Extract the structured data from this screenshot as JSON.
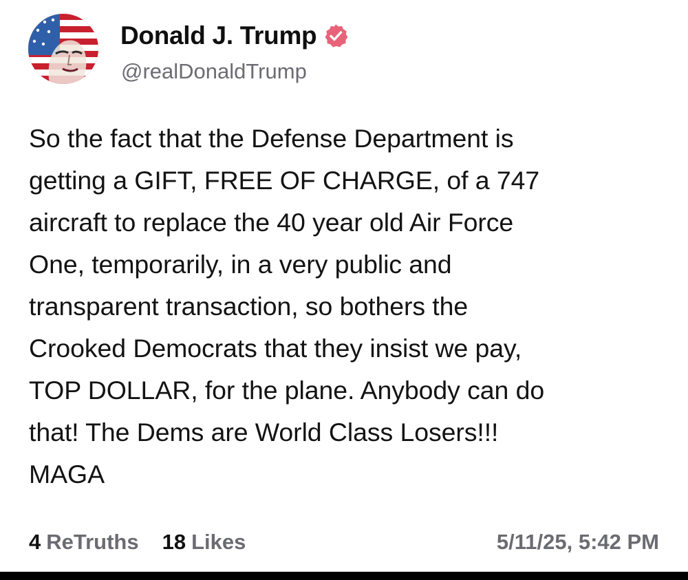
{
  "post": {
    "author": {
      "display_name": "Donald J. Trump",
      "handle": "@realDonaldTrump",
      "verified": true
    },
    "body_lines": [
      "So the fact that the Defense Department is",
      "getting a GIFT, FREE OF CHARGE, of a 747",
      "aircraft to replace the 40 year old Air Force",
      "One, temporarily, in a very public and",
      "transparent transaction, so bothers the",
      "Crooked Democrats that they insist we pay,",
      "TOP DOLLAR, for the plane. Anybody can do",
      "that! The Dems are World Class Losers!!!",
      "MAGA"
    ],
    "stats": {
      "retruths_count": "4",
      "retruths_label": "ReTruths",
      "likes_count": "18",
      "likes_label": "Likes"
    },
    "timestamp": "5/11/25, 5:42 PM"
  },
  "icons": {
    "avatar": "avatar-flag-portrait",
    "verified": "verified-badge-icon"
  },
  "colors": {
    "verified_badge": "#e8637a",
    "secondary_text": "#6b6b72",
    "primary_text": "#111111"
  }
}
